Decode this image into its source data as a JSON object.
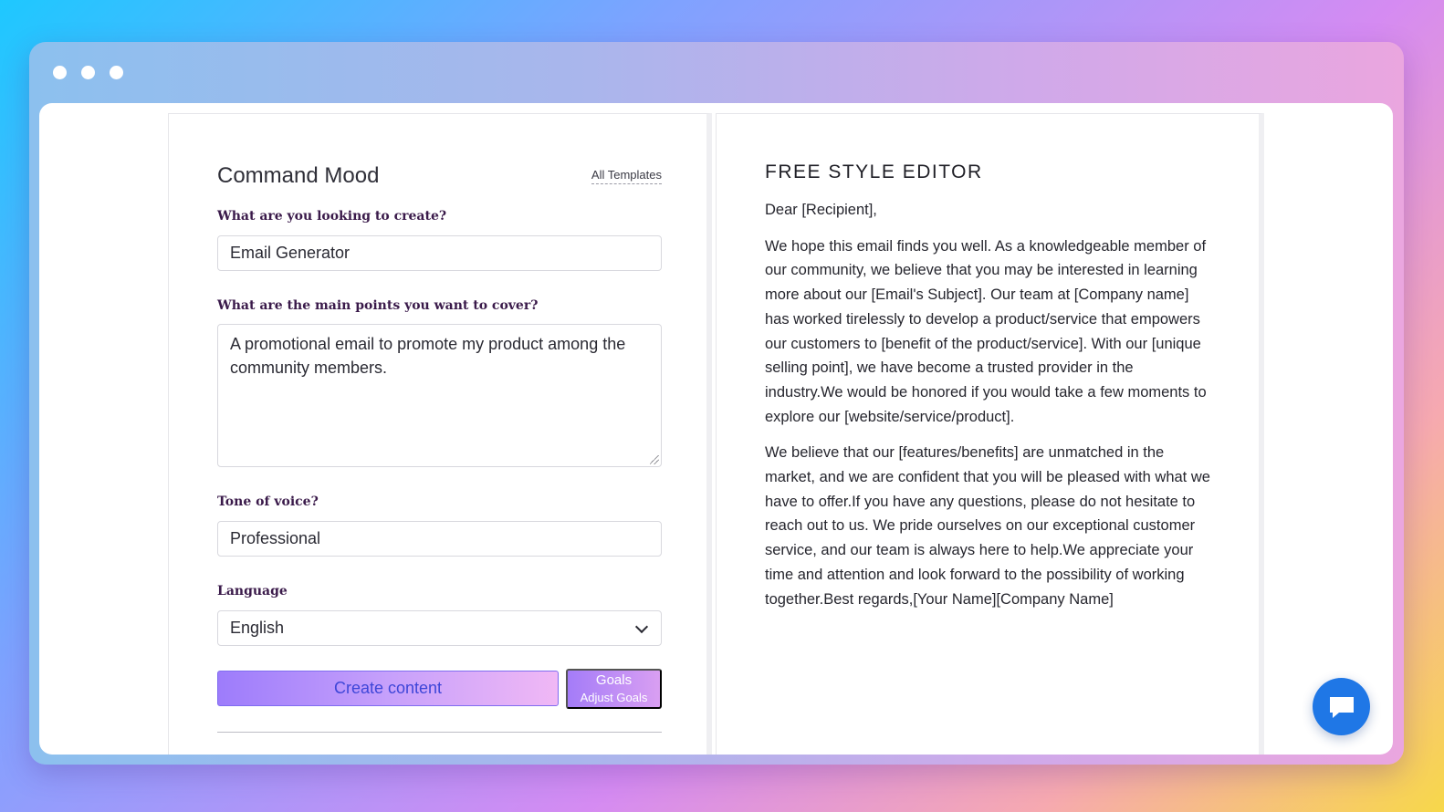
{
  "form": {
    "title": "Command Mood",
    "templates_link": "All Templates",
    "fields": {
      "create_label": "What are you looking to create?",
      "create_value": "Email Generator",
      "points_label": "What are the main points you want to cover?",
      "points_value": "A promotional email to promote my product among the community members.",
      "tone_label": "Tone of voice?",
      "tone_value": "Professional",
      "language_label": "Language",
      "language_value": "English"
    },
    "create_button": "Create content",
    "goals_button": {
      "label": "Goals",
      "sub_label": "Adjust Goals"
    }
  },
  "editor": {
    "title": "FREE STYLE EDITOR",
    "paragraphs": [
      "Dear [Recipient],",
      "We hope this email finds you well. As a knowledgeable member of our community, we believe that you may be interested in learning more about our [Email's Subject]. Our team at [Company name] has worked tirelessly to develop a product/service that empowers our customers to [benefit of the product/service]. With our [unique selling point], we have become a trusted provider in the industry.We would be honored if you would take a few moments to explore our [website/service/product].",
      "We believe that our [features/benefits] are unmatched in the market, and we are confident that you will be pleased with what we have to offer.If you have any questions, please do not hesitate to reach out to us. We pride ourselves on our exceptional customer service, and our team is always here to help.We appreciate your time and attention and look forward to the possibility of working together.Best regards,[Your Name][Company Name]"
    ]
  },
  "icons": {
    "window_controls": [
      "window-dot-icon",
      "window-dot-icon",
      "window-dot-icon"
    ],
    "chat": "chat-bubble-icon",
    "select": "chevron-down-icon",
    "textarea_resize": "resize-handle-icon"
  },
  "colors": {
    "primary_gradient_start": "#9d7cfb",
    "primary_gradient_end": "#f0b8f5",
    "chat_button": "#1f77e6",
    "label_text": "#3a1a4a"
  }
}
